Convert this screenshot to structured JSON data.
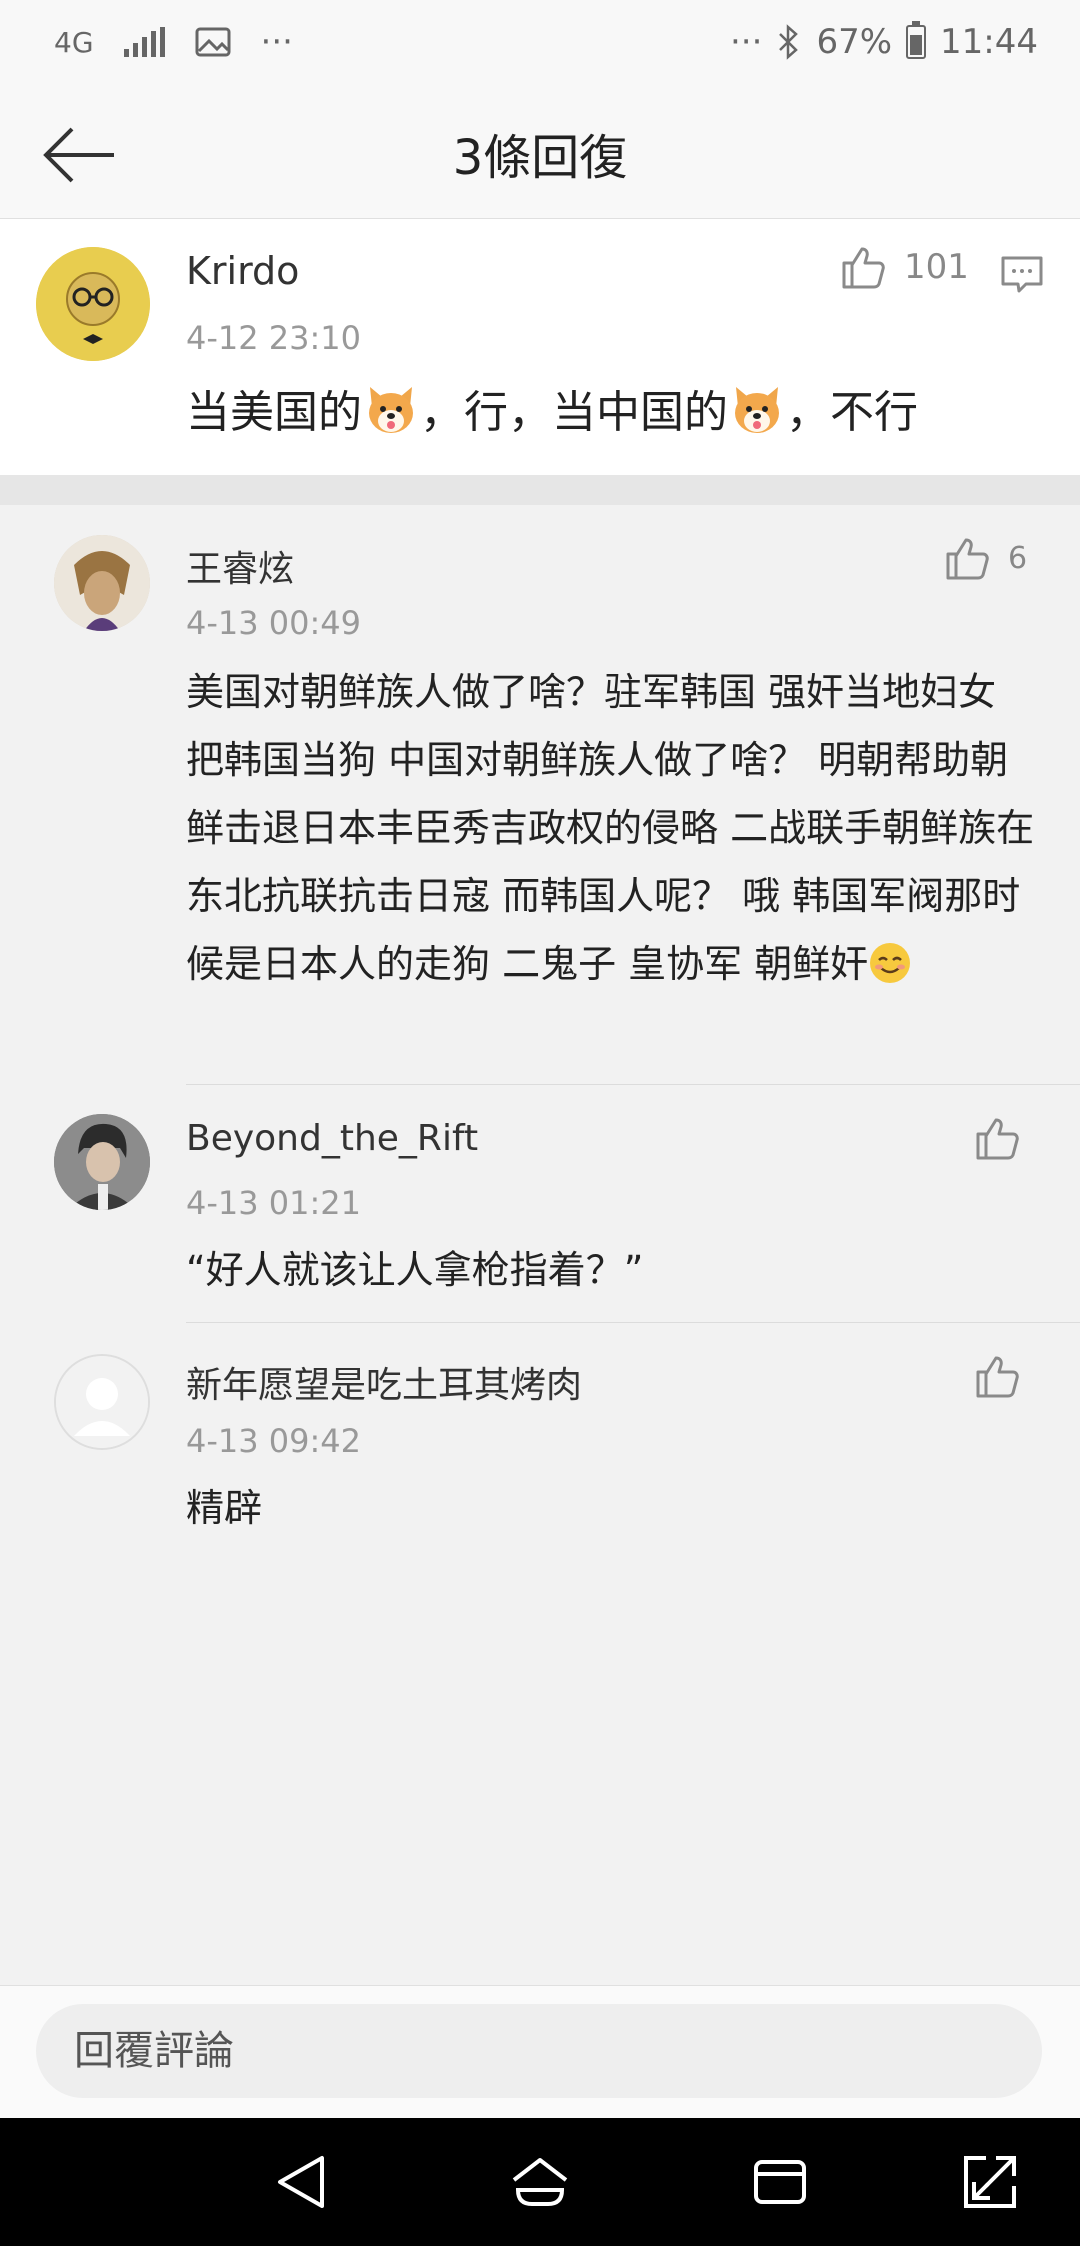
{
  "status_bar": {
    "network": "4G",
    "more_left": "···",
    "more_right": "···",
    "battery": "67%",
    "battery_level": 0.67,
    "time": "11:44"
  },
  "header": {
    "title": "3條回復"
  },
  "main_comment": {
    "username": "Krirdo",
    "time": "4-12 23:10",
    "likes": "101",
    "content_parts": [
      "当美国的",
      "，行，当中国的",
      "，不行"
    ],
    "emoji": "dog-face"
  },
  "replies": [
    {
      "username": "王睿炫",
      "time": "4-13 00:49",
      "likes": "6",
      "content": "美国对朝鲜族人做了啥？驻军韩国  强奸当地妇女 把韩国当狗  中国对朝鲜族人做了啥？ 明朝帮助朝鲜击退日本丰臣秀吉政权的侵略  二战联手朝鲜族在东北抗联抗击日寇 而韩国人呢？ 哦 韩国军阀那时候是日本人的走狗 二鬼子 皇协军 朝鲜奸",
      "emoji": "smiling-face"
    },
    {
      "username": "Beyond_the_Rift",
      "time": "4-13 01:21",
      "likes": "",
      "content": "“好人就该让人拿枪指着？”"
    },
    {
      "username": "新年愿望是吃土耳其烤肉",
      "time": "4-13 09:42",
      "likes": "",
      "content": "精辟"
    }
  ],
  "bottom_bar": {
    "placeholder": "回覆評論"
  },
  "icons": {
    "back": "arrow-left-icon",
    "like": "thumbs-up-icon",
    "reply": "comment-icon",
    "nav": [
      "nav-back-icon",
      "nav-home-icon",
      "nav-recents-icon",
      "nav-expand-icon"
    ]
  },
  "colors": {
    "background": "#f2f2f2",
    "card": "#ffffff",
    "meta_text": "#999999",
    "icon_gray": "#888888"
  }
}
